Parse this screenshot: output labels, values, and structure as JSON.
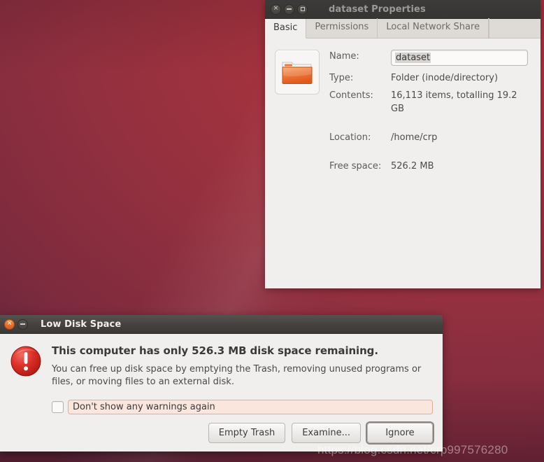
{
  "desktop": {
    "wallpaper_color": "#93303f",
    "accent_color": "#e4702a"
  },
  "watermark": {
    "text": "https://blog.csdn.net/crp997576280"
  },
  "properties_window": {
    "title": "dataset Properties",
    "focused": false,
    "window_buttons": [
      {
        "name": "close",
        "glyph": "×"
      },
      {
        "name": "minimize",
        "glyph": "−"
      },
      {
        "name": "maximize",
        "glyph": "□"
      }
    ],
    "tabs": [
      {
        "label": "Basic",
        "active": true
      },
      {
        "label": "Permissions",
        "active": false
      },
      {
        "label": "Local Network Share",
        "active": false
      }
    ],
    "icon": "folder-icon",
    "fields": {
      "name_label": "Name:",
      "name_value": "dataset",
      "type_label": "Type:",
      "type_value": "Folder (inode/directory)",
      "contents_label": "Contents:",
      "contents_value": "16,113 items, totalling 19.2 GB",
      "location_label": "Location:",
      "location_value": "/home/crp",
      "free_space_label": "Free space:",
      "free_space_value": "526.2 MB"
    }
  },
  "low_disk_dialog": {
    "title": "Low Disk Space",
    "focused": true,
    "window_buttons": [
      {
        "name": "close",
        "glyph": "×"
      },
      {
        "name": "minimize",
        "glyph": "−"
      }
    ],
    "icon": "warning-icon",
    "heading": "This computer has only 526.3 MB disk space remaining.",
    "body": "You can free up disk space by emptying the Trash, removing unused programs or files, or moving files to an external disk.",
    "checkbox": {
      "label": "Don't show any warnings again",
      "checked": false
    },
    "buttons": [
      {
        "label": "Empty Trash",
        "focused": false
      },
      {
        "label": "Examine...",
        "focused": false
      },
      {
        "label": "Ignore",
        "focused": true
      }
    ]
  }
}
